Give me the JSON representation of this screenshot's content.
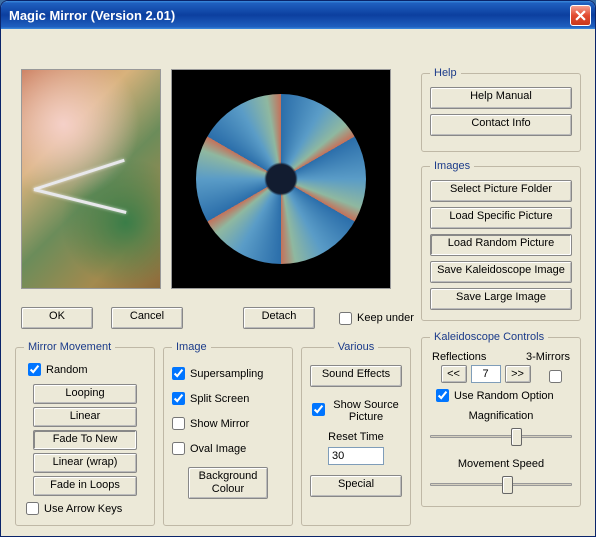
{
  "window": {
    "title": "Magic Mirror (Version 2.01)"
  },
  "help": {
    "legend": "Help",
    "manual": "Help Manual",
    "contact": "Contact Info"
  },
  "images": {
    "legend": "Images",
    "select_folder": "Select Picture Folder",
    "load_specific": "Load Specific Picture",
    "load_random": "Load Random Picture",
    "save_kaleido": "Save Kaleidoscope Image",
    "save_large": "Save Large Image"
  },
  "action_row": {
    "ok": "OK",
    "cancel": "Cancel",
    "detach": "Detach",
    "keep_under": "Keep under",
    "keep_under_checked": false
  },
  "mirror_movement": {
    "legend": "Mirror Movement",
    "random": "Random",
    "random_checked": true,
    "looping": "Looping",
    "linear": "Linear",
    "fade_to_new": "Fade To New",
    "linear_wrap": "Linear (wrap)",
    "fade_in_loops": "Fade in Loops",
    "use_arrow_keys": "Use Arrow Keys",
    "use_arrow_keys_checked": false
  },
  "image_group": {
    "legend": "Image",
    "supersampling": "Supersampling",
    "supersampling_checked": true,
    "split_screen": "Split Screen",
    "split_screen_checked": true,
    "show_mirror": "Show Mirror",
    "show_mirror_checked": false,
    "oval_image": "Oval Image",
    "oval_image_checked": false,
    "background_colour": "Background Colour"
  },
  "various": {
    "legend": "Various",
    "sound_effects": "Sound Effects",
    "show_source": "Show Source Picture",
    "show_source_checked": true,
    "reset_time_label": "Reset Time",
    "reset_time_value": "30",
    "special": "Special"
  },
  "kaleido": {
    "legend": "Kaleidoscope Controls",
    "reflections_label": "Reflections",
    "three_mirrors_label": "3-Mirrors",
    "three_mirrors_checked": false,
    "dec": "<<",
    "inc": ">>",
    "reflections_value": "7",
    "use_random": "Use Random Option",
    "use_random_checked": true,
    "magnification_label": "Magnification",
    "magnification_pos": 0.62,
    "movement_label": "Movement Speed",
    "movement_pos": 0.55
  }
}
